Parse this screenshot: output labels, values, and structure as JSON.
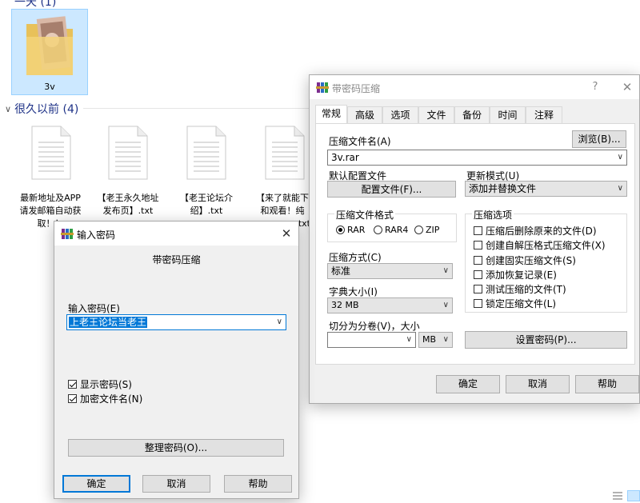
{
  "explorer": {
    "partial_header": "一天 (1)",
    "selected_file": {
      "name": "3v",
      "icon": "folder-with-photo-icon"
    },
    "group": {
      "label": "很久以前 (4)",
      "icon": "chevron-down-icon"
    },
    "files": [
      {
        "line1": "最新地址及APP",
        "line2": "请发邮箱自动获",
        "line3": "取！！",
        "icon": "text-file-icon"
      },
      {
        "line1": "【老王永久地址",
        "line2": "发布页】.txt",
        "line3": "",
        "icon": "text-file-icon"
      },
      {
        "line1": "【老王论坛介",
        "line2": "绍】.txt",
        "line3": "",
        "icon": "text-file-icon"
      },
      {
        "line1": "【来了就能下",
        "line2": "和观看！纯",
        "line3": "txt",
        "icon": "text-file-icon"
      }
    ],
    "view_icons": [
      "details-view-icon",
      "large-icons-view-icon"
    ]
  },
  "archive_dialog": {
    "title": "带密码压缩",
    "app_icon": "winrar-icon",
    "help_btn": "?",
    "close_btn": "✕",
    "tabs": [
      {
        "label": "常规",
        "active": true
      },
      {
        "label": "高级",
        "active": false
      },
      {
        "label": "选项",
        "active": false
      },
      {
        "label": "文件",
        "active": false
      },
      {
        "label": "备份",
        "active": false
      },
      {
        "label": "时间",
        "active": false
      },
      {
        "label": "注释",
        "active": false
      }
    ],
    "archive_name_label": "压缩文件名(A)",
    "browse_btn": "浏览(B)...",
    "archive_name_value": "3v.rar",
    "default_profile_label": "默认配置文件",
    "profile_btn": "配置文件(F)...",
    "update_mode_label": "更新模式(U)",
    "update_mode_value": "添加并替换文件",
    "format_group_label": "压缩文件格式",
    "formats": [
      {
        "label": "RAR",
        "selected": true
      },
      {
        "label": "RAR4",
        "selected": false
      },
      {
        "label": "ZIP",
        "selected": false
      }
    ],
    "options_group_label": "压缩选项",
    "options": [
      {
        "label": "压缩后删除原来的文件(D)",
        "checked": false
      },
      {
        "label": "创建自解压格式压缩文件(X)",
        "checked": false
      },
      {
        "label": "创建固实压缩文件(S)",
        "checked": false
      },
      {
        "label": "添加恢复记录(E)",
        "checked": false
      },
      {
        "label": "测试压缩的文件(T)",
        "checked": false
      },
      {
        "label": "锁定压缩文件(L)",
        "checked": false
      }
    ],
    "method_label": "压缩方式(C)",
    "method_value": "标准",
    "dict_label": "字典大小(I)",
    "dict_value": "32 MB",
    "split_label": "切分为分卷(V)，大小",
    "split_value": "",
    "split_unit": "MB",
    "set_password_btn": "设置密码(P)...",
    "ok_btn": "确定",
    "cancel_btn": "取消",
    "help_text_btn": "帮助"
  },
  "password_dialog": {
    "title": "输入密码",
    "app_icon": "winrar-icon",
    "close_btn": "✕",
    "subtitle": "带密码压缩",
    "password_label": "输入密码(E)",
    "password_value": "上老王论坛当老王",
    "show_password_label": "显示密码(S)",
    "show_password_checked": true,
    "encrypt_names_label": "加密文件名(N)",
    "encrypt_names_checked": true,
    "organize_btn": "整理密码(O)...",
    "ok_btn": "确定",
    "cancel_btn": "取消",
    "help_btn": "帮助"
  },
  "colors": {
    "selection": "#cce8ff",
    "accent": "#0078d7",
    "dialog_bg": "#f0f0f0",
    "group_header": "#1e3287"
  }
}
